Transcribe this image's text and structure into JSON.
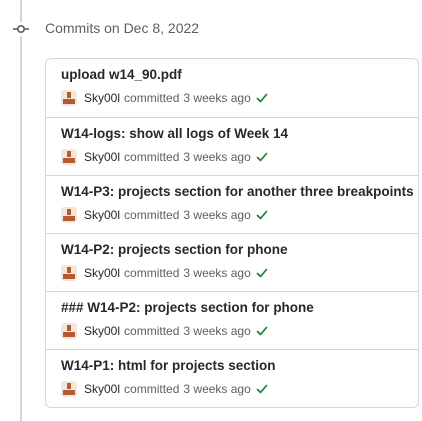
{
  "group": {
    "title": "Commits on Dec 8, 2022"
  },
  "commits": [
    {
      "title": "upload w14_90.pdf",
      "author": "Sky00l",
      "action": "committed",
      "time": "3 weeks ago",
      "status_icon": "check-icon"
    },
    {
      "title": "W14-logs: show all logs of Week 14",
      "author": "Sky00l",
      "action": "committed",
      "time": "3 weeks ago",
      "status_icon": "check-icon"
    },
    {
      "title": "W14-P3: projects section for another three breakpoints",
      "author": "Sky00l",
      "action": "committed",
      "time": "3 weeks ago",
      "status_icon": "check-icon"
    },
    {
      "title": "W14-P2: projects section for phone",
      "author": "Sky00l",
      "action": "committed",
      "time": "3 weeks ago",
      "status_icon": "check-icon"
    },
    {
      "title": "### W14-P2: projects section for phone",
      "author": "Sky00l",
      "action": "committed",
      "time": "3 weeks ago",
      "status_icon": "check-icon"
    },
    {
      "title": "W14-P1: html for projects section",
      "author": "Sky00l",
      "action": "committed",
      "time": "3 weeks ago",
      "status_icon": "check-icon"
    }
  ],
  "colors": {
    "success": "#1a7f37",
    "border": "#d0d7de",
    "muted": "#57606a",
    "avatar_fg": "#b55a32",
    "avatar_bg": "#f3e6dc"
  }
}
